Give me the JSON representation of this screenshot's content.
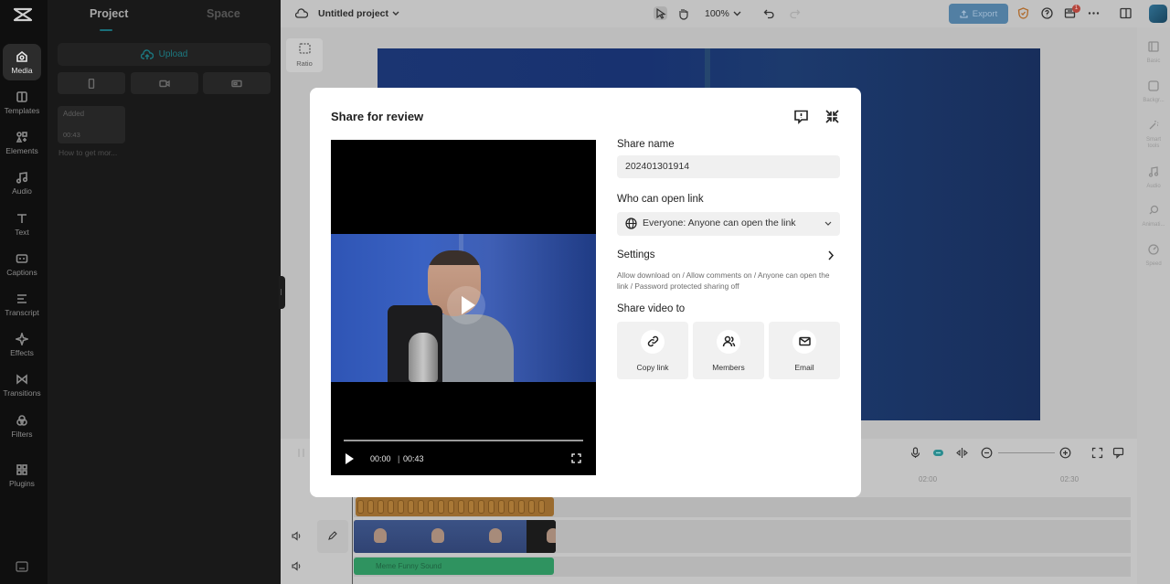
{
  "rail": {
    "items": [
      {
        "label": "Media",
        "icon": "media-icon"
      },
      {
        "label": "Templates",
        "icon": "templates-icon"
      },
      {
        "label": "Elements",
        "icon": "elements-icon"
      },
      {
        "label": "Audio",
        "icon": "audio-icon"
      },
      {
        "label": "Text",
        "icon": "text-icon"
      },
      {
        "label": "Captions",
        "icon": "captions-icon"
      },
      {
        "label": "Transcript",
        "icon": "transcript-icon"
      },
      {
        "label": "Effects",
        "icon": "effects-icon"
      },
      {
        "label": "Transitions",
        "icon": "transitions-icon"
      },
      {
        "label": "Filters",
        "icon": "filters-icon"
      },
      {
        "label": "Plugins",
        "icon": "plugins-icon"
      }
    ]
  },
  "panel": {
    "tabs": [
      "Project",
      "Space"
    ],
    "upload_label": "Upload",
    "media": {
      "badge": "Added",
      "duration": "00:43",
      "title": "How to get mor..."
    }
  },
  "topbar": {
    "project_name": "Untitled project",
    "zoom": "100%",
    "export_label": "Export",
    "notification_count": "1"
  },
  "canvas": {
    "ratio_label": "Ratio"
  },
  "properties": {
    "items": [
      "Basic",
      "Backgr...",
      "Smart tools",
      "Audio",
      "Animati...",
      "Speed"
    ]
  },
  "timeline": {
    "ticks": [
      "02:00",
      "02:30"
    ],
    "sfx_label": "Meme Funny Sound"
  },
  "modal": {
    "title": "Share for review",
    "player": {
      "current_time": "00:00",
      "separator": "|",
      "total_time": "00:43"
    },
    "share_name_label": "Share name",
    "share_name_value": "202401301914",
    "who_label": "Who can open link",
    "who_value": "Everyone: Anyone can open the link",
    "settings_label": "Settings",
    "settings_desc": "Allow download on / Allow comments on / Anyone can open the link / Password protected sharing off",
    "share_to_label": "Share video to",
    "share_options": [
      {
        "label": "Copy link",
        "icon": "link-icon"
      },
      {
        "label": "Members",
        "icon": "members-icon"
      },
      {
        "label": "Email",
        "icon": "email-icon"
      }
    ]
  },
  "colors": {
    "accent": "#1c7880",
    "export_button": "#527fa3",
    "sfx_clip": "#2f9360",
    "audio_clip": "#9a6b2f"
  }
}
